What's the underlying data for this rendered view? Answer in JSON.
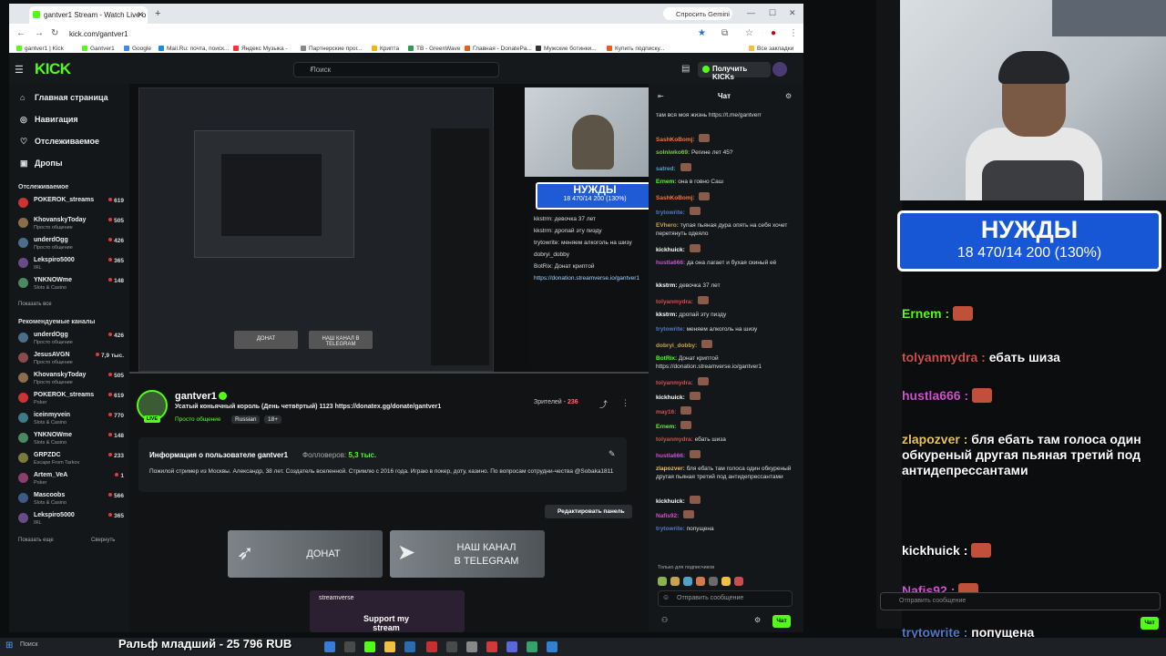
{
  "browser": {
    "tab_title": "gantver1 Stream - Watch Live o",
    "gemini": "Спросить Gemini",
    "url": "kick.com/gantver1",
    "bookmarks": [
      "gantver1 | Kick",
      "Gantver1",
      "Google",
      "Mail.Ru: почта, поиск...",
      "Яндекс Музыка -",
      "Партнерские прог...",
      "Крипта",
      "TB - GreenWave",
      "Главная - DonatePa...",
      "Мужские ботинки...",
      "Купить подписку...",
      "Все закладки"
    ]
  },
  "header": {
    "logo": "KICK",
    "search_placeholder": "Поиск",
    "get_kicks": "Получить KICKs"
  },
  "sidebar": {
    "nav": [
      "Главная страница",
      "Навигация",
      "Отслеживаемое",
      "Дропы"
    ],
    "followed_title": "Отслеживаемое",
    "followed": [
      {
        "name": "POKEROK_streams",
        "category": "",
        "viewers": "619",
        "color": "#c33"
      },
      {
        "name": "KhovanskyToday",
        "category": "Просто общение",
        "viewers": "505",
        "color": "#8a6d4b"
      },
      {
        "name": "underdOgg",
        "category": "Просто общение",
        "viewers": "426",
        "color": "#4b6e8a"
      },
      {
        "name": "Lekspiro5000",
        "category": "IRL",
        "viewers": "365",
        "color": "#6a4b8a"
      },
      {
        "name": "YNKNOWme",
        "category": "Slots & Casino",
        "viewers": "148",
        "color": "#4b8a5e"
      }
    ],
    "followed_more": "Показать все",
    "recommended_title": "Рекомендуемые каналы",
    "recommended": [
      {
        "name": "underdOgg",
        "category": "Просто общение",
        "viewers": "426",
        "color": "#4b6e8a"
      },
      {
        "name": "JesusAVGN",
        "category": "Просто общение",
        "viewers": "7,9 тыс.",
        "color": "#8a4b4b"
      },
      {
        "name": "KhovanskyToday",
        "category": "Просто общение",
        "viewers": "505",
        "color": "#8a6d4b"
      },
      {
        "name": "POKEROK_streams",
        "category": "Poker",
        "viewers": "619",
        "color": "#c33"
      },
      {
        "name": "iceinmyvein",
        "category": "Slots & Casino",
        "viewers": "770",
        "color": "#3f7a8a"
      },
      {
        "name": "YNKNOWme",
        "category": "Slots & Casino",
        "viewers": "148",
        "color": "#4b8a5e"
      },
      {
        "name": "GRPZDC",
        "category": "Escape From Tarkov",
        "viewers": "233",
        "color": "#7a7a3f"
      },
      {
        "name": "Artem_VeA",
        "category": "Poker",
        "viewers": "1",
        "color": "#8a3f6d"
      },
      {
        "name": "Mascoobs",
        "category": "Slots & Casino",
        "viewers": "566",
        "color": "#3f5a8a"
      },
      {
        "name": "Lekspiro5000",
        "category": "IRL",
        "viewers": "365",
        "color": "#6a4b8a"
      }
    ],
    "recommended_more": "Показать еще",
    "collapse": "Свернуть"
  },
  "player": {
    "nuzhdy_title": "НУЖДЫ",
    "nuzhdy_value": "18 470/14 200 (130%)",
    "btn_donate": "ДОНАТ",
    "btn_tg": "НАШ КАНАЛ В TELEGRAM",
    "chat_lines": [
      "kkstrm: девочка 37 лет",
      "kkstrm: дропай эту пизду",
      "trytowrite: меняем алкоголь на шизу",
      "dobryi_dobby",
      "BotRix: Донат криптой",
      "https://donation.streamverse.io/gantver1"
    ]
  },
  "stream": {
    "name": "gantver1",
    "live": "LIVE",
    "title": "Усатый коньячный король (День четвёртый) 1123 https://donatex.gg/donate/gantver1",
    "category": "Просто общение",
    "tags": [
      "Russian",
      "18+"
    ],
    "viewers_label": "Зрителей -",
    "viewers": "236"
  },
  "about": {
    "heading": "Информация о пользователе gantver1",
    "followers_label": "Фолловеров:",
    "followers": "5,3 тыс.",
    "description": "Пожилой стример из Москвы. Александр, 38 лет. Создатель вселенной. Стримлю с 2016 года. Играю в покер, доту, казино. По вопросам сотрудни-чества @Sobaka1811",
    "edit_panel": "Редактировать панель"
  },
  "panels": {
    "donate": "ДОНАТ",
    "telegram_line1": "НАШ КАНАЛ",
    "telegram_line2": "В TELEGRAM",
    "streamverse": "streamverse",
    "support": "Support my stream"
  },
  "chat": {
    "title": "Чат",
    "messages": [
      {
        "user": "",
        "text": "там вся моя жизнь https://t.me/gantverr",
        "color": "#fff"
      },
      {
        "user": "SashKoBomj:",
        "text": "",
        "color": "#e87a3c"
      },
      {
        "user": "solniwko69:",
        "text": "Регине лет 45?",
        "color": "#7ac74f"
      },
      {
        "user": "satred:",
        "text": "",
        "color": "#4fa3c7"
      },
      {
        "user": "Ernem:",
        "text": "она в говно Саш",
        "color": "#53fc18"
      },
      {
        "user": "SashKoBomj:",
        "text": "",
        "color": "#e87a3c"
      },
      {
        "user": "trytowrite:",
        "text": "",
        "color": "#4f7ac7"
      },
      {
        "user": "EVhero:",
        "text": "тупая пьяная дура опять на себя хочет перетянуть одеяло",
        "color": "#c7a34f"
      },
      {
        "user": "kickhuick:",
        "text": "",
        "color": "#fff"
      },
      {
        "user": "hustla666:",
        "text": "да она лагает и бухая скиный её",
        "color": "#d14fd1"
      },
      {
        "user": "kkstrm:",
        "text": "девочка 37 лет",
        "color": "#fff"
      },
      {
        "user": "tolyanmydra:",
        "text": "",
        "color": "#d14f4f"
      },
      {
        "user": "kkstrm:",
        "text": "дропай эту пизду",
        "color": "#fff"
      },
      {
        "user": "trytowrite:",
        "text": "меняем алкоголь на шизу",
        "color": "#4f7ac7"
      },
      {
        "user": "dobryi_dobby:",
        "text": "",
        "color": "#c7a34f"
      },
      {
        "user": "BotRix:",
        "text": "Донат криптой https://donation.streamverse.io/gantver1",
        "color": "#53fc18"
      },
      {
        "user": "tolyanmydra:",
        "text": "",
        "color": "#d14f4f"
      },
      {
        "user": "kickhuick:",
        "text": "",
        "color": "#fff"
      },
      {
        "user": "may16:",
        "text": "",
        "color": "#d14f4f"
      },
      {
        "user": "Ernem:",
        "text": "",
        "color": "#53fc18"
      },
      {
        "user": "tolyanmydra:",
        "text": "ебать шиза",
        "color": "#d14f4f"
      },
      {
        "user": "hustla666:",
        "text": "",
        "color": "#d14fd1"
      },
      {
        "user": "zlapozver:",
        "text": "бля ебать там голоса один обкуреный другая пьяная третий под антидепрессантами",
        "color": "#e8c64f"
      },
      {
        "user": "kickhuick:",
        "text": "",
        "color": "#fff"
      },
      {
        "user": "Nafis92:",
        "text": "",
        "color": "#d14fd1"
      },
      {
        "user": "trytowrite:",
        "text": "попущена",
        "color": "#4f7ac7"
      }
    ],
    "sub_only": "Только для подписчиков",
    "input_placeholder": "Отправить сообщение",
    "send": "Чат"
  },
  "overlay": {
    "nuzhdy_title": "НУЖДЫ",
    "nuzhdy_value": "18 470/14 200 (130%)",
    "lines": [
      {
        "user": "Ernem",
        "text": "",
        "big": true,
        "color": "#53fc18"
      },
      {
        "user": "tolyanmydra",
        "text": "ебать шиза",
        "big": true,
        "color": "#d14f4f"
      },
      {
        "user": "hustla666",
        "text": "",
        "big": true,
        "color": "#d14fd1"
      },
      {
        "user": "zlapozver",
        "text": "бля ебать там голоса один обкуреный другая пьяная третий под антидепрессантами",
        "big": true,
        "color": "#e8c64f"
      },
      {
        "user": "kickhuick",
        "text": "",
        "big": true,
        "color": "#fff"
      },
      {
        "user": "Nafis92",
        "text": "",
        "big": true,
        "color": "#d14fd1"
      },
      {
        "user": "trytowrite",
        "text": "попущена",
        "big": true,
        "color": "#4f7ac7"
      }
    ],
    "input_placeholder": "Отправить сообщение",
    "send": "Чат"
  },
  "taskbar": {
    "search": "Поиск",
    "ticker": "Ральф младший - 25 796 RUB"
  }
}
